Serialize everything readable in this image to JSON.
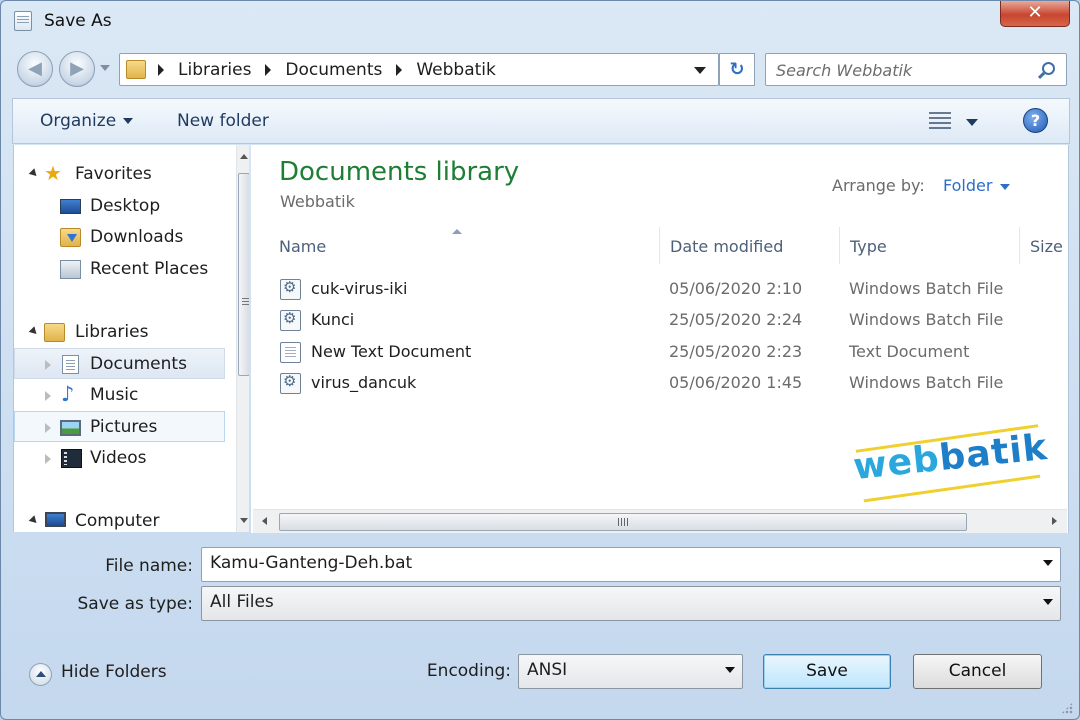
{
  "window": {
    "title": "Save As",
    "close_label": "✕"
  },
  "address": {
    "crumbs": [
      "Libraries",
      "Documents",
      "Webbatik"
    ],
    "refresh_symbol": "↻"
  },
  "search": {
    "placeholder": "Search Webbatik"
  },
  "toolbar": {
    "organize_label": "Organize",
    "new_folder_label": "New folder",
    "help_label": "?"
  },
  "nav": {
    "favorites_label": "Favorites",
    "desktop_label": "Desktop",
    "downloads_label": "Downloads",
    "recent_label": "Recent Places",
    "libraries_label": "Libraries",
    "documents_label": "Documents",
    "music_label": "Music",
    "pictures_label": "Pictures",
    "videos_label": "Videos",
    "computer_label": "Computer"
  },
  "library": {
    "title": "Documents library",
    "subtitle": "Webbatik",
    "arrange_label": "Arrange by:",
    "arrange_value": "Folder"
  },
  "columns": {
    "name": "Name",
    "date": "Date modified",
    "type": "Type",
    "size": "Size"
  },
  "files": [
    {
      "name": "cuk-virus-iki",
      "date": "05/06/2020 2:10",
      "type": "Windows Batch File"
    },
    {
      "name": "Kunci",
      "date": "25/05/2020 2:24",
      "type": "Windows Batch File"
    },
    {
      "name": "New Text Document",
      "date": "25/05/2020 2:23",
      "type": "Text Document"
    },
    {
      "name": "virus_dancuk",
      "date": "05/06/2020 1:45",
      "type": "Windows Batch File"
    }
  ],
  "watermark": {
    "part1": "web",
    "part2": "batik"
  },
  "form": {
    "filename_label": "File name:",
    "filename_value": "Kamu-Ganteng-Deh.bat",
    "savetype_label": "Save as type:",
    "savetype_value": "All Files",
    "encoding_label": "Encoding:",
    "encoding_value": "ANSI"
  },
  "buttons": {
    "hide_folders": "Hide Folders",
    "save": "Save",
    "cancel": "Cancel"
  }
}
